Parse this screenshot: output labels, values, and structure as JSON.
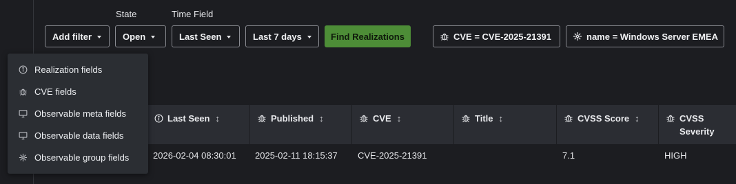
{
  "filters": {
    "add_filter_label": "Add filter",
    "state_label": "State",
    "state_value": "Open",
    "time_field_label": "Time Field",
    "time_field_value": "Last Seen",
    "time_range_value": "Last 7 days",
    "find_button": "Find Realizations"
  },
  "chips": [
    {
      "text": "CVE = CVE-2025-21391",
      "icon": "bug-icon"
    },
    {
      "text": "name = Windows Server EMEA",
      "icon": "group-icon"
    }
  ],
  "menu": {
    "items": [
      {
        "label": "Realization fields",
        "icon": "info-icon"
      },
      {
        "label": "CVE fields",
        "icon": "bug-icon"
      },
      {
        "label": "Observable meta fields",
        "icon": "monitor-icon"
      },
      {
        "label": "Observable data fields",
        "icon": "monitor-icon"
      },
      {
        "label": "Observable group fields",
        "icon": "group-icon"
      }
    ]
  },
  "table": {
    "columns": [
      {
        "label": "Last Seen",
        "icon": "info-icon"
      },
      {
        "label": "Published",
        "icon": "bug-icon"
      },
      {
        "label": "CVE",
        "icon": "bug-icon"
      },
      {
        "label": "Title",
        "icon": "bug-icon"
      },
      {
        "label": "CVSS Score",
        "icon": "bug-icon"
      },
      {
        "label": "CVSS Severity",
        "icon": "bug-icon"
      }
    ],
    "sort_glyph": "↕",
    "rows": [
      [
        "2026-02-04 08:30:01",
        "2025-02-11 18:15:37",
        "CVE-2025-21391",
        "",
        "7.1",
        "HIGH"
      ]
    ]
  }
}
